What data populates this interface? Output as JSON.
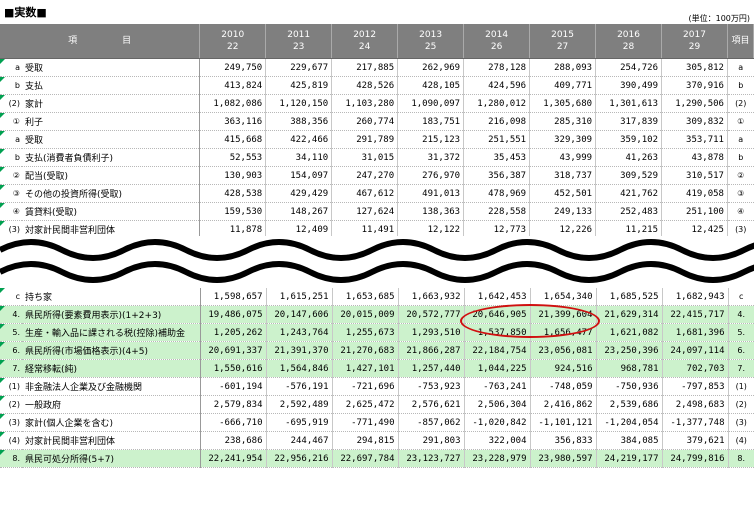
{
  "title": "■実数■",
  "unit": "(単位：100万円)",
  "header": {
    "item_label": "項　　　　　目",
    "years": [
      {
        "y": "2010",
        "h": "22"
      },
      {
        "y": "2011",
        "h": "23"
      },
      {
        "y": "2012",
        "h": "24"
      },
      {
        "y": "2013",
        "h": "25"
      },
      {
        "y": "2014",
        "h": "26"
      },
      {
        "y": "2015",
        "h": "27"
      },
      {
        "y": "2016",
        "h": "28"
      },
      {
        "y": "2017",
        "h": "29"
      }
    ],
    "right_label": "項目"
  },
  "top_rows": [
    {
      "mk": "a",
      "label": "受取",
      "vals": [
        "249,750",
        "229,677",
        "217,885",
        "262,969",
        "278,128",
        "288,093",
        "254,726",
        "305,812"
      ],
      "rm": "a"
    },
    {
      "mk": "b",
      "label": "支払",
      "vals": [
        "413,824",
        "425,819",
        "428,526",
        "428,105",
        "424,596",
        "409,771",
        "390,499",
        "370,916"
      ],
      "rm": "b"
    },
    {
      "mk": "(2)",
      "label": "家計",
      "vals": [
        "1,082,086",
        "1,120,150",
        "1,103,280",
        "1,090,097",
        "1,280,012",
        "1,305,680",
        "1,301,613",
        "1,290,506"
      ],
      "rm": "(2)"
    },
    {
      "mk": "①",
      "label": "利子",
      "vals": [
        "363,116",
        "388,356",
        "260,774",
        "183,751",
        "216,098",
        "285,310",
        "317,839",
        "309,832"
      ],
      "rm": "①"
    },
    {
      "mk": "a",
      "label": "受取",
      "vals": [
        "415,668",
        "422,466",
        "291,789",
        "215,123",
        "251,551",
        "329,309",
        "359,102",
        "353,711"
      ],
      "rm": "a"
    },
    {
      "mk": "b",
      "label": "支払(消費者負債利子)",
      "vals": [
        "52,553",
        "34,110",
        "31,015",
        "31,372",
        "35,453",
        "43,999",
        "41,263",
        "43,878"
      ],
      "rm": "b"
    },
    {
      "mk": "②",
      "label": "配当(受取)",
      "vals": [
        "130,903",
        "154,097",
        "247,270",
        "276,970",
        "356,387",
        "318,737",
        "309,529",
        "310,517"
      ],
      "rm": "②"
    },
    {
      "mk": "③",
      "label": "その他の投資所得(受取)",
      "vals": [
        "428,538",
        "429,429",
        "467,612",
        "491,013",
        "478,969",
        "452,501",
        "421,762",
        "419,058"
      ],
      "rm": "③"
    },
    {
      "mk": "④",
      "label": "賃貸料(受取)",
      "vals": [
        "159,530",
        "148,267",
        "127,624",
        "138,363",
        "228,558",
        "249,133",
        "252,483",
        "251,100"
      ],
      "rm": "④"
    },
    {
      "mk": "(3)",
      "label": "対家計民間非営利団体",
      "vals": [
        "11,878",
        "12,409",
        "11,491",
        "12,122",
        "12,773",
        "12,226",
        "11,215",
        "12,425"
      ],
      "rm": "(3)"
    }
  ],
  "bottom_rows": [
    {
      "mk": "c",
      "label": "持ち家",
      "vals": [
        "1,598,657",
        "1,615,251",
        "1,653,685",
        "1,663,932",
        "1,642,453",
        "1,654,340",
        "1,685,525",
        "1,682,943"
      ],
      "rm": "c",
      "green": false
    },
    {
      "mk": "4.",
      "label": "県民所得(要素費用表示)(1+2+3)",
      "vals": [
        "19,486,075",
        "20,147,606",
        "20,015,009",
        "20,572,777",
        "20,646,905",
        "21,399,604",
        "21,629,314",
        "22,415,717"
      ],
      "rm": "4.",
      "green": true
    },
    {
      "mk": "5.",
      "label": "生産・輸入品に課される税(控除)補助金",
      "vals": [
        "1,205,262",
        "1,243,764",
        "1,255,673",
        "1,293,510",
        "1,537,850",
        "1,656,477",
        "1,621,082",
        "1,681,396"
      ],
      "rm": "5.",
      "green": true
    },
    {
      "mk": "6.",
      "label": "県民所得(市場価格表示)(4+5)",
      "vals": [
        "20,691,337",
        "21,391,370",
        "21,270,683",
        "21,866,287",
        "22,184,754",
        "23,056,081",
        "23,250,396",
        "24,097,114"
      ],
      "rm": "6.",
      "green": true
    },
    {
      "mk": "7.",
      "label": "経常移転(純)",
      "vals": [
        "1,550,616",
        "1,564,846",
        "1,427,101",
        "1,257,440",
        "1,044,225",
        "924,516",
        "968,781",
        "702,703"
      ],
      "rm": "7.",
      "green": true
    },
    {
      "mk": "(1)",
      "label": "非金融法人企業及び金融機関",
      "vals": [
        "-601,194",
        "-576,191",
        "-721,696",
        "-753,923",
        "-763,241",
        "-748,059",
        "-750,936",
        "-797,853"
      ],
      "rm": "(1)",
      "green": false
    },
    {
      "mk": "(2)",
      "label": "一般政府",
      "vals": [
        "2,579,834",
        "2,592,489",
        "2,625,472",
        "2,576,621",
        "2,506,304",
        "2,416,862",
        "2,539,686",
        "2,498,683"
      ],
      "rm": "(2)",
      "green": false
    },
    {
      "mk": "(3)",
      "label": "家計(個人企業を含む)",
      "vals": [
        "-666,710",
        "-695,919",
        "-771,490",
        "-857,062",
        "-1,020,842",
        "-1,101,121",
        "-1,204,054",
        "-1,377,748"
      ],
      "rm": "(3)",
      "green": false
    },
    {
      "mk": "(4)",
      "label": "対家計民間非営利団体",
      "vals": [
        "238,686",
        "244,467",
        "294,815",
        "291,803",
        "322,004",
        "356,833",
        "384,085",
        "379,621"
      ],
      "rm": "(4)",
      "green": false
    },
    {
      "mk": "8.",
      "label": "県民可処分所得(5+7)",
      "vals": [
        "22,241,954",
        "22,956,216",
        "22,697,784",
        "23,123,727",
        "23,228,979",
        "23,980,597",
        "24,219,177",
        "24,799,816"
      ],
      "rm": "8.",
      "green": true
    }
  ]
}
